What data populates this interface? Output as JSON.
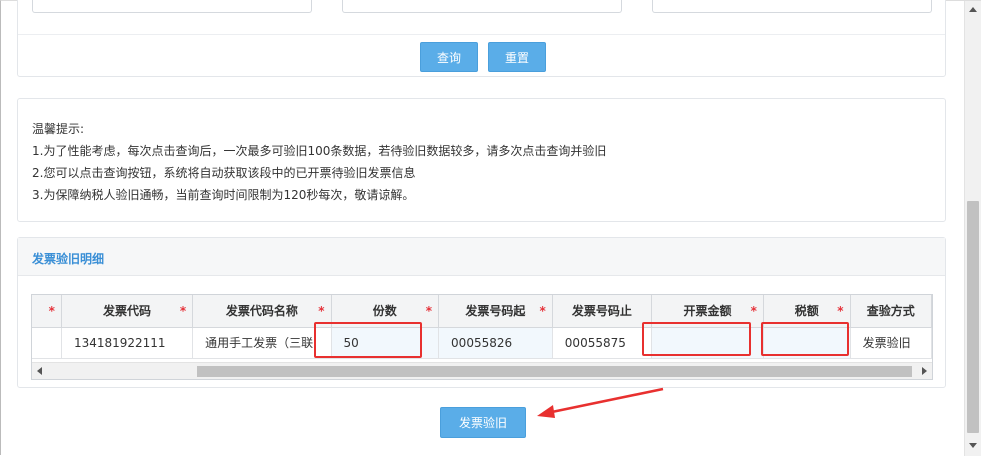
{
  "search": {
    "query_button": "查询",
    "reset_button": "重置"
  },
  "tips": {
    "title": "温馨提示:",
    "lines": [
      "1.为了性能考虑，每次点击查询后，一次最多可验旧100条数据，若待验旧数据较多，请多次点击查询并验旧",
      "2.您可以点击查询按钮，系统将自动获取该段中的已开票待验旧发票信息",
      "3.为保障纳税人验旧通畅，当前查询时间限制为120秒每次，敬请谅解。"
    ]
  },
  "detail": {
    "title": "发票验旧明细",
    "columns": [
      "发票代码",
      "发票代码名称",
      "份数",
      "发票号码起",
      "发票号码止",
      "开票金额",
      "税额",
      "查验方式"
    ],
    "required_mark": "*",
    "row": {
      "invoice_code": "134181922111",
      "invoice_code_name": "通用手工发票（三联",
      "count": "50",
      "number_start": "00055826",
      "number_end": "00055875",
      "amount": "",
      "tax": "",
      "check_method": "发票验旧"
    }
  },
  "verify_button": "发票验旧",
  "colors": {
    "accent": "#5aade8",
    "header_text": "#3a8fd6",
    "required": "#e5323a",
    "annotation": "#e8302f"
  }
}
